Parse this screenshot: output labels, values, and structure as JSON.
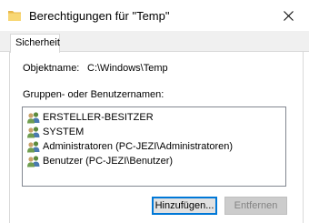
{
  "window": {
    "title": "Berechtigungen für \"Temp\""
  },
  "tabs": [
    {
      "label": "Sicherheit"
    }
  ],
  "object": {
    "label": "Objektname:",
    "value": "C:\\Windows\\Temp"
  },
  "groups": {
    "label": "Gruppen- oder Benutzernamen:",
    "items": [
      {
        "name": "ERSTELLER-BESITZER",
        "icon": "user-group-icon"
      },
      {
        "name": "SYSTEM",
        "icon": "user-group-icon"
      },
      {
        "name": "Administratoren (PC-JEZI\\Administratoren)",
        "icon": "user-group-icon"
      },
      {
        "name": "Benutzer (PC-JEZI\\Benutzer)",
        "icon": "user-group-icon"
      }
    ]
  },
  "buttons": {
    "add": "Hinzufügen...",
    "remove": "Entfernen"
  },
  "colors": {
    "accent": "#0078d7",
    "folder": "#f8d775",
    "disabled_text": "#838383"
  }
}
